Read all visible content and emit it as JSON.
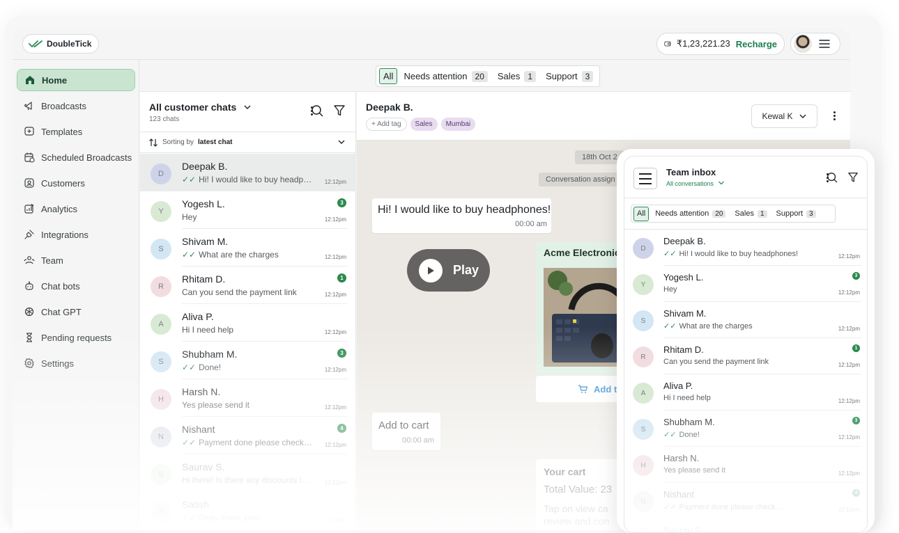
{
  "brand": {
    "name": "DoubleTick"
  },
  "header": {
    "balance": "₹1,23,221.23",
    "recharge_label": "Recharge"
  },
  "sidebar": {
    "items": [
      {
        "label": "Home",
        "icon": "home-icon",
        "active": true
      },
      {
        "label": "Broadcasts",
        "icon": "megaphone-icon"
      },
      {
        "label": "Templates",
        "icon": "template-icon"
      },
      {
        "label": "Scheduled Broadcasts",
        "icon": "calendar-icon"
      },
      {
        "label": "Customers",
        "icon": "contact-icon"
      },
      {
        "label": "Analytics",
        "icon": "analytics-icon"
      },
      {
        "label": "Integrations",
        "icon": "plug-icon"
      },
      {
        "label": "Team",
        "icon": "team-icon"
      },
      {
        "label": "Chat bots",
        "icon": "bot-icon"
      },
      {
        "label": "Chat GPT",
        "icon": "openai-icon"
      },
      {
        "label": "Pending requests",
        "icon": "hourglass-icon"
      },
      {
        "label": "Settings",
        "icon": "gear-icon"
      }
    ]
  },
  "filters": [
    {
      "label": "All",
      "active": true
    },
    {
      "label": "Needs attention",
      "count": "20"
    },
    {
      "label": "Sales",
      "count": "1"
    },
    {
      "label": "Support",
      "count": "3"
    }
  ],
  "chatlist": {
    "title": "All customer chats",
    "subtitle": "123 chats",
    "sort_prefix": "Sorting by",
    "sort_value": "latest chat",
    "chats": [
      {
        "initial": "D",
        "name": "Deepak B.",
        "msg": "Hi! I would like to buy headphones!",
        "time": "12:12pm",
        "ticks": true,
        "unread": "",
        "color": "#cfd3ea"
      },
      {
        "initial": "Y",
        "name": "Yogesh L.",
        "msg": "Hey",
        "time": "12:12pm",
        "ticks": false,
        "unread": "3",
        "color": "#d8ead3"
      },
      {
        "initial": "S",
        "name": "Shivam M.",
        "msg": "What are the charges",
        "time": "12:12pm",
        "ticks": true,
        "unread": "",
        "color": "#d3e6f3"
      },
      {
        "initial": "R",
        "name": "Rhitam D.",
        "msg": "Can you send the payment link",
        "time": "12:12pm",
        "ticks": false,
        "unread": "1",
        "color": "#f1dde0"
      },
      {
        "initial": "A",
        "name": "Aliva P.",
        "msg": "Hi I need help",
        "time": "12:12pm",
        "ticks": false,
        "unread": "",
        "color": "#d8ead3"
      },
      {
        "initial": "S",
        "name": "Shubham M.",
        "msg": "Done!",
        "time": "12:12pm",
        "ticks": true,
        "unread": "3",
        "color": "#d3e6f3"
      },
      {
        "initial": "H",
        "name": "Harsh N.",
        "msg": "Yes please send it",
        "time": "12:12pm",
        "ticks": false,
        "unread": "",
        "color": "#f1dde0"
      },
      {
        "initial": "N",
        "name": "Nishant",
        "msg": "Payment done please check the status",
        "time": "12:12pm",
        "ticks": true,
        "unread": "4",
        "color": "#dcdfe8"
      },
      {
        "initial": "S",
        "name": "Saurav S.",
        "msg": "Hi there! Is there any discounts in this",
        "time": "12:12pm",
        "ticks": false,
        "unread": "",
        "color": "#d8ead3"
      },
      {
        "initial": "S",
        "name": "Satish",
        "msg": "Okay thank you!",
        "time": "12:12pm",
        "ticks": true,
        "unread": "",
        "color": "#d3e6f3"
      }
    ]
  },
  "conversation": {
    "name": "Deepak B.",
    "add_tag": "+ Add tag",
    "tags": [
      "Sales",
      "Mumbai"
    ],
    "agent": "Kewal K",
    "date_chip": "18th Oct 2",
    "system_chip": "Conversation assign",
    "messages": [
      {
        "text": "Hi! I would like to buy headphones!",
        "time": "00:00 am"
      },
      {
        "text": "Add to cart",
        "time": "00:00 am"
      }
    ],
    "play_label": "Play",
    "product_title": "Acme Electronics",
    "add_to_cart": "Add t",
    "cart_title": "Your cart",
    "cart_total": "Total Value: 23",
    "cart_line1": "Tap on view ca",
    "cart_line2": "review and con"
  },
  "mobile": {
    "title": "Team inbox",
    "subtitle": "All conversations",
    "chats": [
      {
        "initial": "D",
        "name": "Deepak B.",
        "msg": "Hi! I would like to buy headphones!",
        "time": "12:12pm",
        "ticks": true,
        "unread": "",
        "color": "#cfd3ea"
      },
      {
        "initial": "Y",
        "name": "Yogesh L.",
        "msg": "Hey",
        "time": "12:12pm",
        "ticks": false,
        "unread": "3",
        "color": "#d8ead3"
      },
      {
        "initial": "S",
        "name": "Shivam M.",
        "msg": "What are the charges",
        "time": "12:12pm",
        "ticks": true,
        "unread": "",
        "color": "#d3e6f3"
      },
      {
        "initial": "R",
        "name": "Rhitam D.",
        "msg": "Can you send the payment link",
        "time": "12:12pm",
        "ticks": false,
        "unread": "1",
        "color": "#f1dde0"
      },
      {
        "initial": "A",
        "name": "Aliva P.",
        "msg": "Hi I need help",
        "time": "12:12pm",
        "ticks": false,
        "unread": "",
        "color": "#d8ead3"
      },
      {
        "initial": "S",
        "name": "Shubham M.",
        "msg": "Done!",
        "time": "12:12pm",
        "ticks": true,
        "unread": "3",
        "color": "#d3e6f3"
      },
      {
        "initial": "H",
        "name": "Harsh N.",
        "msg": "Yes please send it",
        "time": "12:12pm",
        "ticks": false,
        "unread": "",
        "color": "#f1dde0"
      },
      {
        "initial": "N",
        "name": "Nishant",
        "msg": "Payment done please check...",
        "time": "12:12pm",
        "ticks": true,
        "unread": "4",
        "color": "#dcdfe8"
      },
      {
        "initial": "S",
        "name": "Saurav S.",
        "msg": "",
        "time": "",
        "ticks": false,
        "unread": "",
        "color": "#d8ead3"
      }
    ]
  }
}
